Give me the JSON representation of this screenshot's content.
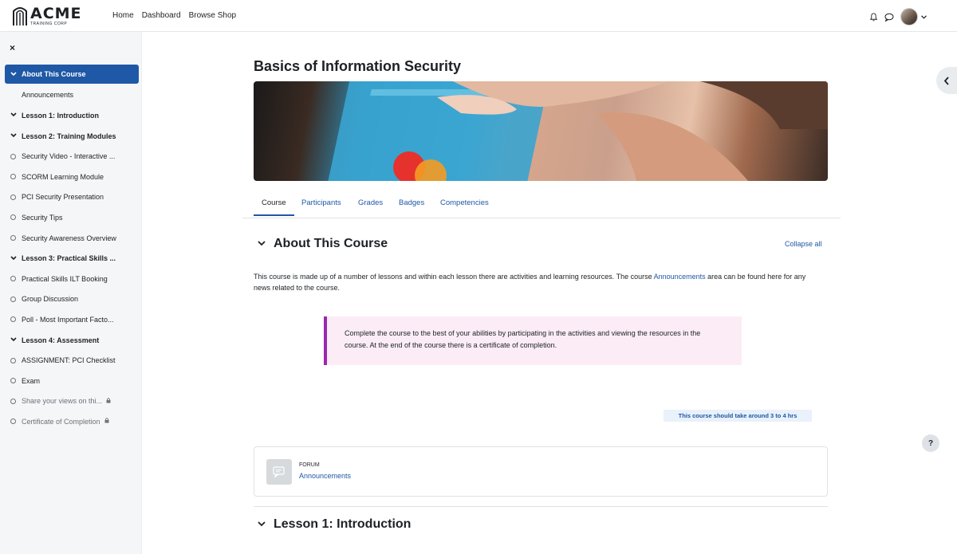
{
  "brand": {
    "name": "ACME",
    "tagline": "TRAINING CORP"
  },
  "nav": {
    "links": [
      "Home",
      "Dashboard",
      "Browse Shop"
    ]
  },
  "icons": {
    "notifications": "bell-icon",
    "messages": "chat-bubble-icon",
    "user_menu": "chevron-down-icon",
    "close": "close-icon",
    "drawer": "chevron-left-icon",
    "help": "question-icon",
    "forum": "forum-icon",
    "lock": "lock-icon"
  },
  "sidebar": {
    "close_label": "×",
    "items": [
      {
        "label": "About This Course",
        "kind": "section-active"
      },
      {
        "label": "Announcements",
        "kind": "child"
      },
      {
        "label": "Lesson 1: Introduction",
        "kind": "section"
      },
      {
        "label": "Lesson 2: Training Modules",
        "kind": "section"
      },
      {
        "label": "Security Video - Interactive ...",
        "kind": "activity"
      },
      {
        "label": "SCORM Learning Module",
        "kind": "activity"
      },
      {
        "label": "PCI Security Presentation",
        "kind": "activity"
      },
      {
        "label": "Security Tips",
        "kind": "activity"
      },
      {
        "label": "Security Awareness Overview",
        "kind": "activity"
      },
      {
        "label": "Lesson 3: Practical Skills ...",
        "kind": "section"
      },
      {
        "label": "Practical Skills ILT Booking",
        "kind": "activity"
      },
      {
        "label": "Group Discussion",
        "kind": "activity"
      },
      {
        "label": "Poll - Most Important Facto...",
        "kind": "activity"
      },
      {
        "label": "Lesson 4: Assessment",
        "kind": "section"
      },
      {
        "label": "ASSIGNMENT: PCI Checklist",
        "kind": "activity"
      },
      {
        "label": "Exam",
        "kind": "activity"
      },
      {
        "label": "Share your views on thi...",
        "kind": "activity-locked"
      },
      {
        "label": "Certificate of Completion",
        "kind": "activity-locked"
      }
    ]
  },
  "course": {
    "title": "Basics of Information Security",
    "tabs": [
      "Course",
      "Participants",
      "Grades",
      "Badges",
      "Competencies"
    ],
    "active_tab": "Course",
    "section_title": "About This Course",
    "collapse_all": "Collapse all",
    "description_before": "This course is made up of a number of lessons and within each lesson there are activities and learning resources. The course ",
    "description_link": "Announcements",
    "description_after": " area can be found here for any news related to the course.",
    "callout": "Complete the course to the best of your abilities by participating in the activities and viewing the resources in the course. At the end of the course there is a certificate of completion.",
    "duration": "This course should take around 3 to 4 hrs",
    "activity": {
      "type": "FORUM",
      "name": "Announcements"
    },
    "next_section_title": "Lesson 1: Introduction"
  },
  "help_label": "?",
  "colors": {
    "accent": "#1f58a6",
    "callout_border": "#9c27b0",
    "callout_bg": "#fbecf6"
  }
}
